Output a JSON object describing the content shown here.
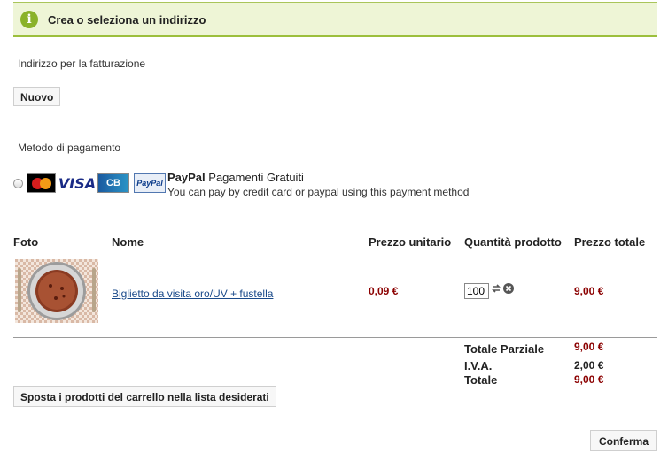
{
  "banner": {
    "title": "Crea o seleziona un indirizzo",
    "icon": "info-icon"
  },
  "billing": {
    "label": "Indirizzo per la fatturazione",
    "new_button": "Nuovo"
  },
  "payment": {
    "label": "Metodo di pagamento",
    "method_name": "PayPal",
    "method_suffix": "Pagamenti Gratuiti",
    "description": "You can pay by credit card or paypal using this payment method",
    "cards": [
      "mastercard",
      "visa",
      "cb",
      "paypal"
    ],
    "card_labels": {
      "visa": "VISA",
      "cb": "CB",
      "paypal": "PayPal"
    }
  },
  "cart": {
    "headers": {
      "photo": "Foto",
      "name": "Nome",
      "unit_price": "Prezzo unitario",
      "quantity": "Quantità prodotto",
      "total_price": "Prezzo totale"
    },
    "item": {
      "name": "Biglietto da visita oro/UV + fustella",
      "unit_price": "0,09 €",
      "quantity": "100",
      "total_price": "9,00 €"
    },
    "totals": {
      "subtotal_label": "Totale Parziale",
      "subtotal": "9,00 €",
      "vat_label": "I.V.A.",
      "vat": "2,00 €",
      "total_label": "Totale",
      "total": "9,00 €"
    },
    "move_to_wishlist": "Sposta i prodotti del carrello nella lista desiderati"
  },
  "confirm_button": "Conferma",
  "colors": {
    "accent_green": "#9cbf3c",
    "price_red": "#8b0000",
    "link_blue": "#1a4a8a"
  }
}
